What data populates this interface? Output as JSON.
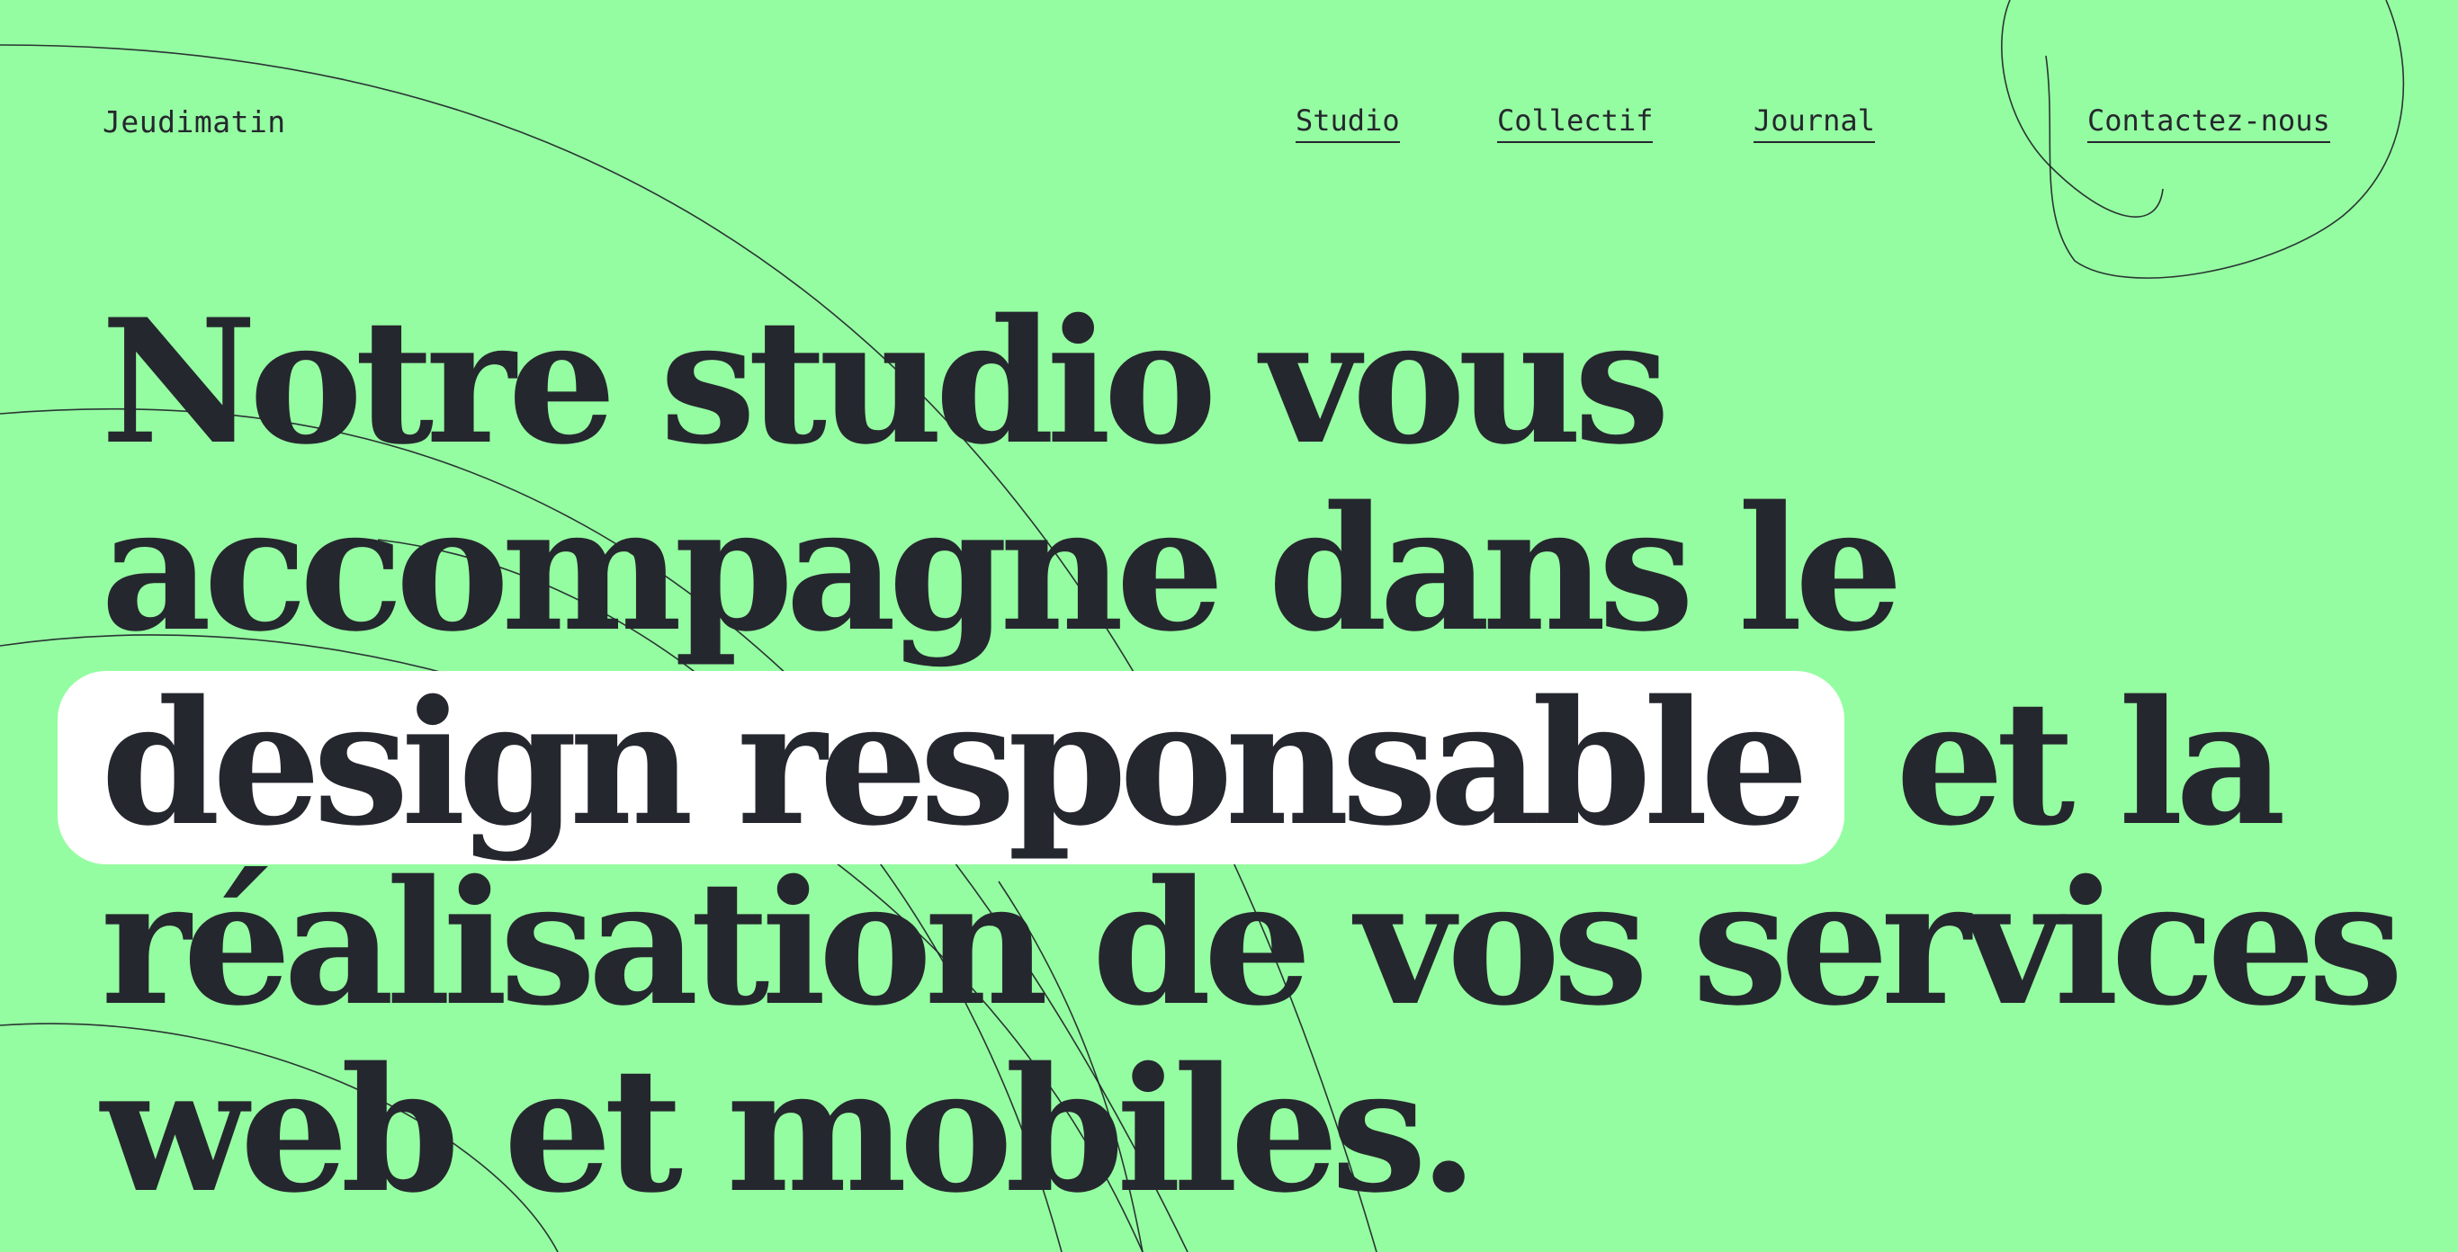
{
  "brand": "Jeudimatin",
  "nav": {
    "studio": "Studio",
    "collectif": "Collectif",
    "journal": "Journal",
    "contact": "Contactez-nous"
  },
  "hero": {
    "line1": "Notre studio vous",
    "line2": "accompagne dans le",
    "highlight": "design responsable",
    "line3_after": " et la",
    "line4": "réalisation de vos services",
    "line5": "web et mobiles."
  },
  "colors": {
    "background": "#95fda1",
    "text": "#25272e",
    "highlight": "#ffffff",
    "lines": "#1f2429"
  }
}
